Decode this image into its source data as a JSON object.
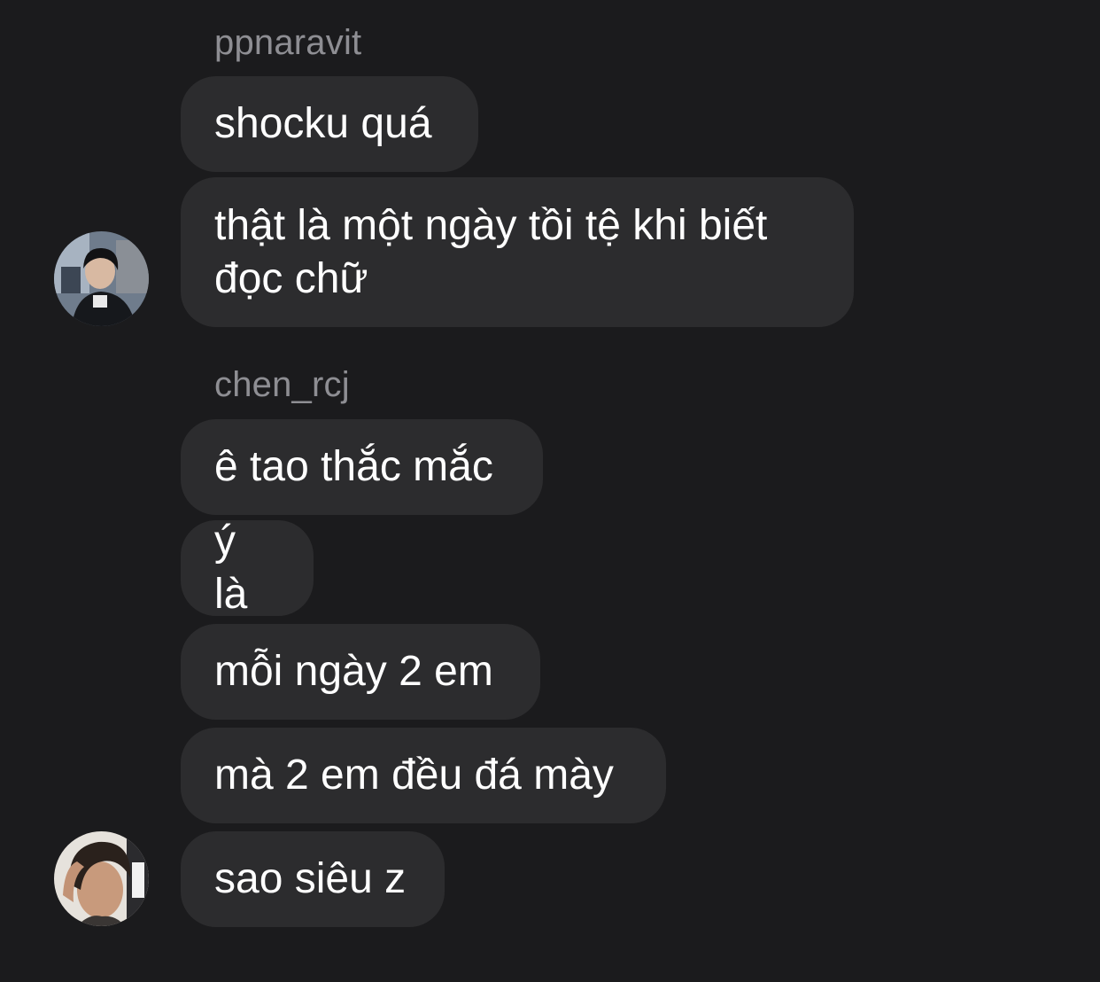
{
  "conversation": {
    "groups": [
      {
        "sender": "ppnaravit",
        "avatar_icon": "profile-photo",
        "messages": [
          "shocku quá",
          "thật là một ngày tồi tệ khi biết đọc chữ"
        ]
      },
      {
        "sender": "chen_rcj",
        "avatar_icon": "profile-photo",
        "messages": [
          "ê tao thắc mắc",
          "ý là",
          "mỗi ngày 2 em",
          "mà 2 em đều đá mày",
          "sao siêu z"
        ]
      }
    ]
  },
  "colors": {
    "background": "#1b1b1d",
    "bubble": "#2c2c2e",
    "sender_text": "#8e8e93",
    "message_text": "#ffffff"
  }
}
